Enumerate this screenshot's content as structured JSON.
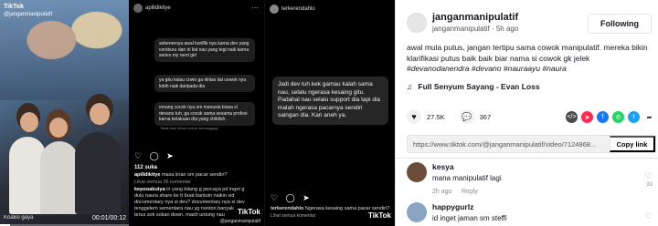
{
  "panel1": {
    "brand": "TikTok",
    "handle": "@janganmanipulatif",
    "bottom_text": "Koalisi gaya",
    "time": "00:01/00:12",
    "progress": 0.08
  },
  "panel2": {
    "username": "apilldikitye",
    "card1": "sebenernya awal konflik nya karna dev yang cemburu dan iri liat nau yang tegi naik karna series my nerd girl",
    "card2": "ya gitu kalau cowo ga ikhlas liat cewek nya lebih naik daripada dia",
    "card3": "emang cocok nya sm manusia biasa si devano tuh, ga cocok sama sesama profesi karna kelakuan dia yang childish.",
    "card3_note": "Tidak ikan Isihan untuk menanggapi",
    "likes": "112 suka",
    "caption_user": "apilldikitye",
    "caption_text": "masa iinan sm pacar sendiri?",
    "comments_link": "Lihat semua 36 komentar",
    "comment1_user": "kepooakutya",
    "comment1_text": "iri yang bilang g percaya pd inget g",
    "comment1_line2": "dulu naura share ke tt buat bantuin naikin vid",
    "comment1_line3": "documentary nya si dev? documentary nya si dev",
    "comment1_line4": "tenggelem sementara nau yg nonton banyak",
    "comment1_line5": "terus sok sokan down. mash untung nau",
    "brand": "TikTok",
    "tiktok_handle": "@janganmanipulatif"
  },
  "panel3": {
    "username": "terkerendahlo",
    "quote": "Jadi dev tuh kek gamau kalah sama nau, selalu ngerasa kesaing gitu. Padahal nau selalu support dia tapi dia malah ngerasa pacarnya sendiri saingan dia. Kan aneh ya.",
    "caption_user": "terkerendahlo",
    "caption_text": "Ngerasa kesaing sama pacar sendiri?",
    "caption2": "Lihat semua komentar",
    "brand": "TikTok"
  },
  "panel4": {
    "author_name": "janganmanipulatif",
    "author_handle": "janganmanipulatif",
    "author_time": "5h ago",
    "follow_label": "Following",
    "description": "awal mula putus, jangan tertipu sama cowok manipulatif. mereka bikin klarifikasi putus baik baik biar nama si cowok gk jelek",
    "hashtags": "#devanodanendra #devano #nauraayu #naura",
    "music": "Full Senyum Sayang - Evan Loss",
    "likes": "27.5K",
    "comments": "367",
    "share_colors": {
      "embed": "#4a4a4a",
      "telegram": "#fe2c55",
      "facebook": "#1877f2",
      "whatsapp": "#25d366",
      "twitter": "#1da1f2"
    },
    "link": "https://www.tiktok.com/@janganmanipulatif/video/7124868...",
    "copy_label": "Copy link",
    "comments_list": [
      {
        "name": "kesya",
        "text": "mana manipulatif lagi",
        "time": "2h ago",
        "reply": "Reply",
        "likes": "33",
        "avatar_color": "#6b4d3a"
      },
      {
        "name": "happygurlz",
        "text": "id inget jaman sm steffi",
        "time": "",
        "reply": "",
        "likes": "",
        "avatar_color": "#8aa5c1"
      }
    ]
  }
}
